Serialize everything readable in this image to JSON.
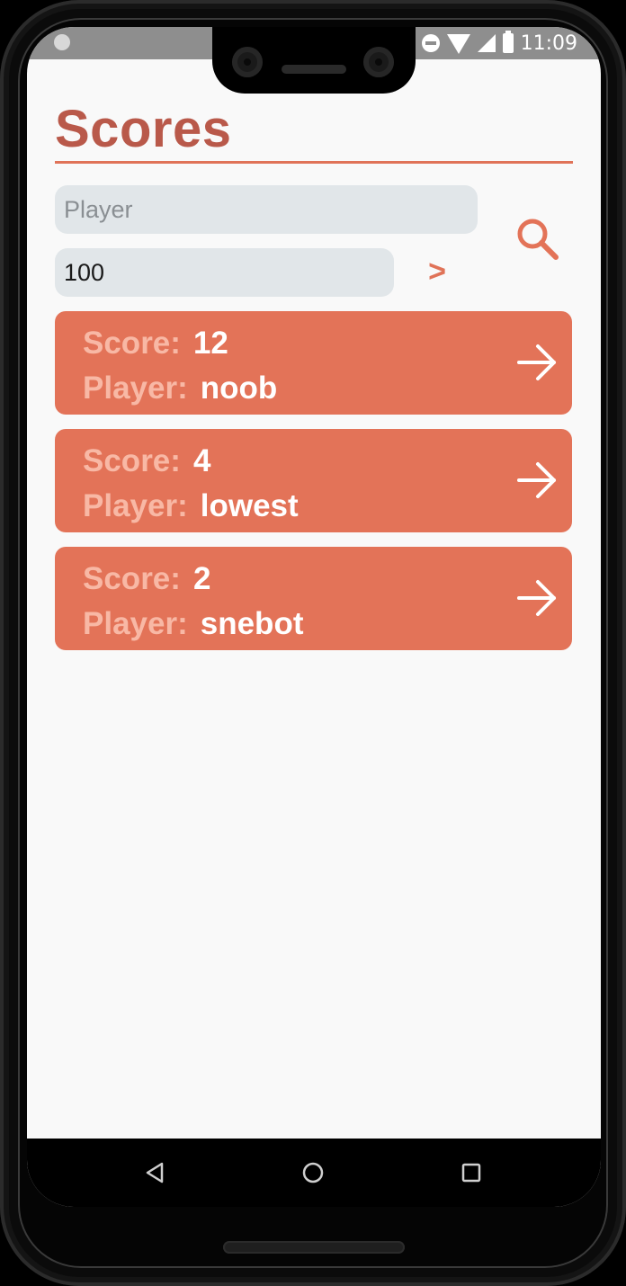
{
  "status_bar": {
    "time": "11:09"
  },
  "header": {
    "title": "Scores"
  },
  "search": {
    "player_placeholder": "Player",
    "player_value": "",
    "limit_value": "100",
    "go_label": ">"
  },
  "scores": [
    {
      "score_label": "Score:",
      "score": "12",
      "player_label": "Player:",
      "player": "noob"
    },
    {
      "score_label": "Score:",
      "score": "4",
      "player_label": "Player:",
      "player": "lowest"
    },
    {
      "score_label": "Score:",
      "score": "2",
      "player_label": "Player:",
      "player": "snebot"
    }
  ],
  "colors": {
    "accent": "#e37358",
    "title": "#b9594a",
    "label": "#f8b8a5",
    "input_bg": "#e1e6e9",
    "background": "#f9f9f9"
  },
  "icons": {
    "search": "search-icon",
    "card_arrow": "arrow-right-icon",
    "nav_back": "back-triangle-icon",
    "nav_home": "home-circle-icon",
    "nav_recents": "recents-square-icon"
  }
}
